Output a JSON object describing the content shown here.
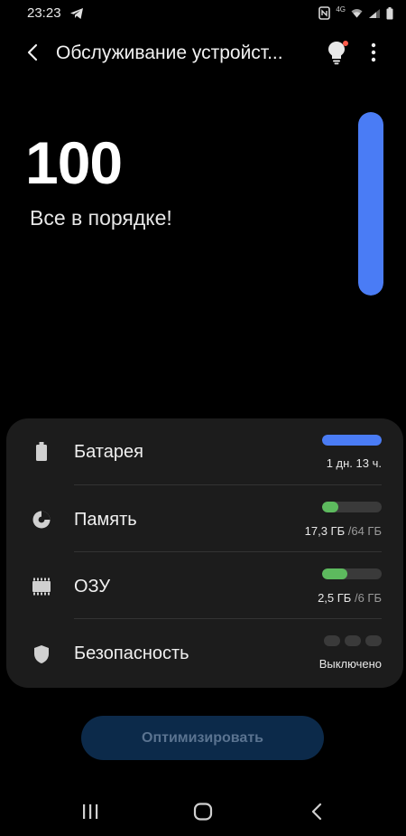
{
  "status_bar": {
    "time": "23:23",
    "icons": [
      "telegram-icon",
      "nfc-icon",
      "wifi-icon",
      "signal-icon",
      "battery-icon"
    ],
    "network_label": "4G"
  },
  "app_bar": {
    "title": "Обслуживание устройст...",
    "icons": [
      "back-icon",
      "lightbulb-icon",
      "more-vert-icon"
    ]
  },
  "score": {
    "value": "100",
    "status": "Все в порядке!",
    "gauge_fraction": 1.0
  },
  "items": [
    {
      "id": "battery",
      "label": "Батарея",
      "value": "1 дн. 13 ч.",
      "total": "",
      "icon": "battery-icon",
      "fraction": 1.0,
      "color": "#4a7cf5"
    },
    {
      "id": "storage",
      "label": "Память",
      "value": "17,3 ГБ",
      "total": "/64 ГБ",
      "icon": "storage-pie-icon",
      "fraction": 0.27,
      "color": "#5dba5e"
    },
    {
      "id": "ram",
      "label": "ОЗУ",
      "value": "2,5 ГБ",
      "total": "/6 ГБ",
      "icon": "memory-chip-icon",
      "fraction": 0.42,
      "color": "#5dba5e"
    },
    {
      "id": "security",
      "label": "Безопасность",
      "value": "Выключено",
      "total": "",
      "icon": "shield-icon"
    }
  ],
  "actions": {
    "optimize_label": "Оптимизировать"
  },
  "colors": {
    "accent": "#4a7cf5",
    "ok_green": "#5dba5e",
    "card_bg": "#1c1c1c",
    "button_bg": "#0c2a4a"
  },
  "nav_bar": {
    "icons": [
      "recents-icon",
      "home-icon",
      "back-nav-icon"
    ]
  }
}
